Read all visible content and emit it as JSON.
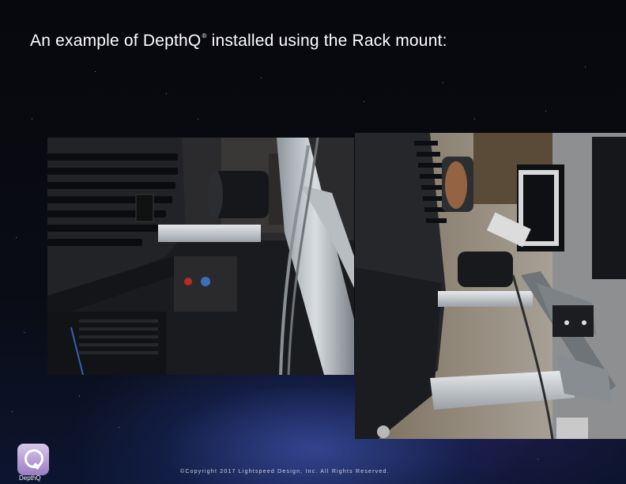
{
  "slide": {
    "title_text": "An example of Depth",
    "title_q": "Q",
    "title_reg": "®",
    "title_rest": " installed using the Rack mount:"
  },
  "logo": {
    "text": "DepthQ"
  },
  "footer": {
    "copyright": "©Copyright 2017 Lightspeed Design, Inc. All Rights Reserved."
  },
  "colors": {
    "background": "#05070c",
    "title": "#ffffff",
    "logo_accent": "#9b7cc3"
  }
}
